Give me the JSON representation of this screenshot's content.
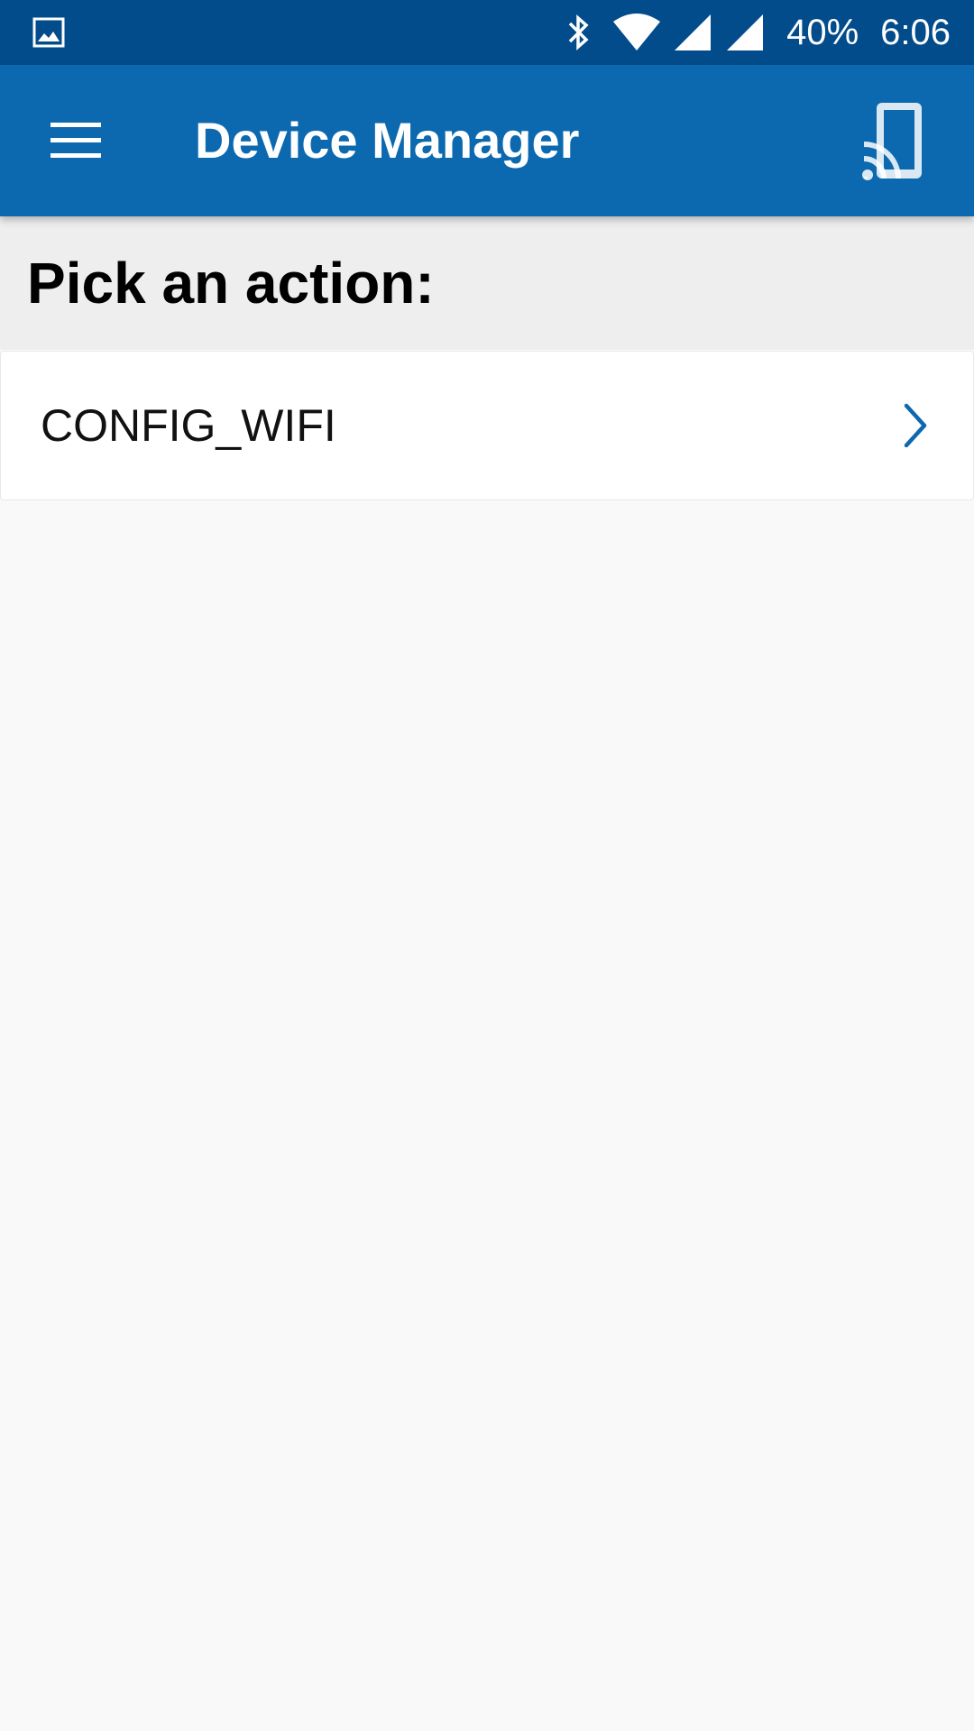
{
  "status_bar": {
    "left_icon": "image-notification-icon",
    "battery_text": "40%",
    "time": "6:06",
    "icons": [
      "bluetooth-icon",
      "wifi-icon",
      "signal-icon",
      "signal-icon"
    ]
  },
  "app_bar": {
    "title": "Device Manager",
    "menu_icon": "hamburger-menu-icon",
    "cast_icon": "cast-device-icon",
    "color": "#0c69af"
  },
  "section": {
    "title": "Pick an action:"
  },
  "actions": {
    "items": [
      {
        "label": "CONFIG_WIFI",
        "icon": "chevron-right-icon"
      }
    ]
  },
  "colors": {
    "status_bar": "#034c8b",
    "app_bar": "#0c69af",
    "accent": "#0c69af",
    "section_bg": "#eeeeee",
    "content_bg": "#f9f9f9"
  }
}
